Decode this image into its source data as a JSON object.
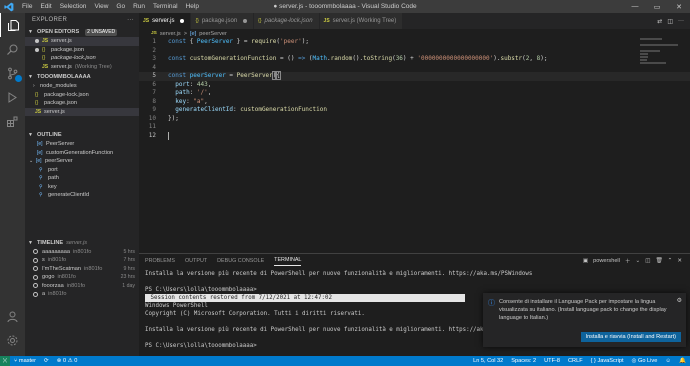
{
  "titlebar": {
    "menu": [
      "File",
      "Edit",
      "Selection",
      "View",
      "Go",
      "Run",
      "Terminal",
      "Help"
    ],
    "title": "● server.js - tooommbolaaaa - Visual Studio Code",
    "minimize": "—",
    "maximize": "▭",
    "close": "✕"
  },
  "sidebar": {
    "explorer_title": "EXPLORER",
    "explorer_more": "···",
    "open_editors": {
      "title": "OPEN EDITORS",
      "badge": "2 UNSAVED",
      "items": [
        {
          "marker": "●",
          "icon": "JS",
          "name": "server.js",
          "extra": ""
        },
        {
          "marker": "●",
          "icon": "{}",
          "name": "package.json",
          "extra": ""
        },
        {
          "marker": "",
          "icon": "{}",
          "name": "package-lock.json",
          "extra": ""
        },
        {
          "marker": "",
          "icon": "JS",
          "name": "server.js",
          "extra": "(Working Tree)"
        }
      ]
    },
    "workspace": {
      "title": "TOOOMMBOLAAAA",
      "items": [
        {
          "kind": "folder",
          "name": "node_modules"
        },
        {
          "kind": "json",
          "name": "package-lock.json"
        },
        {
          "kind": "json",
          "name": "package.json"
        },
        {
          "kind": "js",
          "name": "server.js"
        }
      ]
    },
    "outline": {
      "title": "OUTLINE",
      "items": [
        {
          "name": "PeerServer",
          "indent": 1,
          "icon": "[e]"
        },
        {
          "name": "customGenerationFunction",
          "indent": 1,
          "icon": "[e]"
        },
        {
          "name": "peerServer",
          "indent": 0,
          "icon": "[e]"
        },
        {
          "name": "port",
          "indent": 2,
          "icon": "🔧"
        },
        {
          "name": "path",
          "indent": 2,
          "icon": "🔧"
        },
        {
          "name": "key",
          "indent": 2,
          "icon": "🔧"
        },
        {
          "name": "generateClientId",
          "indent": 2,
          "icon": "🔧"
        }
      ]
    },
    "timeline": {
      "title": "TIMELINE",
      "file": "server.js",
      "items": [
        {
          "name": "aaaaaaaaa",
          "hash": "in801fo",
          "time": "5 hrs"
        },
        {
          "name": "s",
          "hash": "in801fo",
          "time": "7 hrs"
        },
        {
          "name": "I'mTheScatman",
          "hash": "in801fo",
          "time": "9 hrs"
        },
        {
          "name": "gogo",
          "hash": "in801fo",
          "time": "23 hrs"
        },
        {
          "name": "fooorzaa",
          "hash": "in801fo",
          "time": "1 day"
        },
        {
          "name": "a",
          "hash": "in801fo",
          "time": ""
        }
      ]
    }
  },
  "tabs": [
    {
      "icon": "JS",
      "label": "server.js",
      "italic": false,
      "dirty": true,
      "active": true
    },
    {
      "icon": "{}",
      "label": "package.json",
      "italic": false,
      "dirty": true,
      "active": false
    },
    {
      "icon": "{}",
      "label": "package-lock.json",
      "italic": true,
      "dirty": false,
      "active": false
    },
    {
      "icon": "JS",
      "label": "server.js (Working Tree)",
      "italic": false,
      "dirty": false,
      "active": false
    }
  ],
  "breadcrumb": {
    "file": "server.js",
    "sep": ">",
    "symbol": "peerServer"
  },
  "editor": {
    "lines": [
      "1",
      "2",
      "3",
      "4",
      "5",
      "6",
      "7",
      "8",
      "9",
      "10",
      "11",
      "12"
    ]
  },
  "panel": {
    "tabs": [
      "PROBLEMS",
      "OUTPUT",
      "DEBUG CONSOLE",
      "TERMINAL"
    ],
    "active_tab": "TERMINAL",
    "shell": "powershell",
    "terminal_lines": [
      "Installa la versione più recente di PowerShell per nuove funzionalità e miglioramenti. https://aka.ms/PSWindows",
      "",
      "PS C:\\Users\\lolla\\tooommbolaaaa>",
      "",
      "Windows PowerShell",
      "Copyright (C) Microsoft Corporation. Tutti i diritti riservati.",
      "",
      "Installa la versione più recente di PowerShell per nuove funzionalità e miglioramenti. https://aka.ms/PSWindows",
      "",
      "PS C:\\Users\\lolla\\tooommbolaaaa>"
    ],
    "restored_banner": " Session contents restored from 7/12/2021 at 12:47:02 "
  },
  "notification": {
    "message": "Consente di installare il Language Pack per impostare la lingua visualizzata su italiano. (Install language pack to change the display language to Italian.)",
    "button": "Installa e riavvia (Install and Restart)"
  },
  "statusbar": {
    "branch": "master",
    "sync": "⟳",
    "errors": "⊗ 0 ⚠ 0",
    "position": "Ln 5, Col 32",
    "spaces": "Spaces: 2",
    "encoding": "UTF-8",
    "eol": "CRLF",
    "language": "JavaScript",
    "golive": "Go Live"
  },
  "colors": {
    "accent": "#007acc",
    "titlebar": "#3c3c3c",
    "sidebar": "#252526",
    "editor": "#1e1e1e",
    "button": "#0e639c"
  }
}
